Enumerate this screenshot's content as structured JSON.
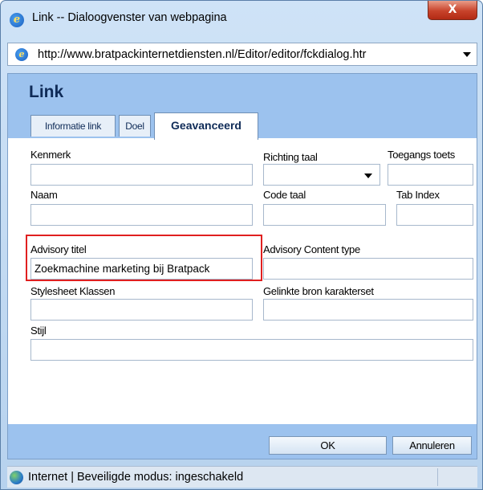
{
  "window": {
    "title": "Link -- Dialoogvenster van webpagina",
    "close_label": "X",
    "app_icon": "ie-logo-icon"
  },
  "address": {
    "url": "http://www.bratpackinternetdiensten.nl/Editor/editor/fckdialog.htr"
  },
  "dialog": {
    "title": "Link",
    "tabs": [
      {
        "label": "Informatie link",
        "active": false
      },
      {
        "label": "Doel",
        "active": false
      },
      {
        "label": "Geavanceerd",
        "active": true
      }
    ],
    "fields": {
      "kenmerk": {
        "label": "Kenmerk",
        "value": ""
      },
      "richting_taal": {
        "label": "Richting taal",
        "value": ""
      },
      "toegangs_toets": {
        "label": "Toegangs toets",
        "value": ""
      },
      "naam": {
        "label": "Naam",
        "value": ""
      },
      "code_taal": {
        "label": "Code taal",
        "value": ""
      },
      "tab_index": {
        "label": "Tab Index",
        "value": ""
      },
      "advisory_titel": {
        "label": "Advisory titel",
        "value": "Zoekmachine marketing bij Bratpack"
      },
      "advisory_content_type": {
        "label": "Advisory Content type",
        "value": ""
      },
      "stylesheet_klassen": {
        "label": "Stylesheet Klassen",
        "value": ""
      },
      "gelinkte_bron_karakterset": {
        "label": "Gelinkte bron karakterset",
        "value": ""
      },
      "stijl": {
        "label": "Stijl",
        "value": ""
      }
    },
    "buttons": {
      "ok": "OK",
      "cancel": "Annuleren"
    }
  },
  "status": {
    "zone_text": "Internet | Beveiligde modus: ingeschakeld"
  },
  "colors": {
    "header_bg": "#9cc2ee",
    "highlight_border": "#e02020",
    "title_color": "#0f2b57"
  }
}
